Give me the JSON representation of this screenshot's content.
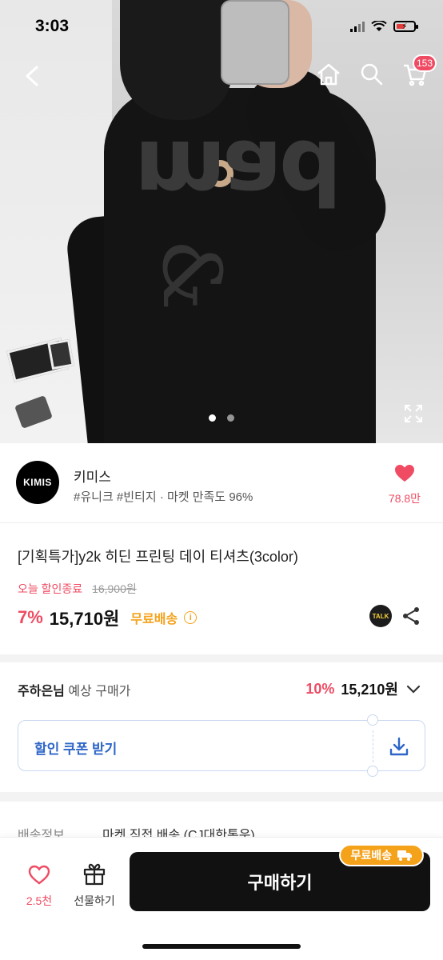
{
  "status_bar": {
    "time": "3:03"
  },
  "nav": {
    "cart_count": "153"
  },
  "gallery": {
    "image_count": 2,
    "active_index": 0,
    "print_text": "mad",
    "print_amp": "&"
  },
  "shop": {
    "logo_text": "KIMIS",
    "name": "키미스",
    "tags": "#유니크 #빈티지 · 마켓 만족도 96%",
    "like_count": "78.8만"
  },
  "product": {
    "title": "[기획특가]y2k 히딘 프린팅 데이 티셔츠(3color)",
    "sale_label": "오늘 할인종료",
    "original_price": "16,900원",
    "discount": "7%",
    "price": "15,710원",
    "free_shipping": "무료배송",
    "talk_label": "TALK"
  },
  "expected_price": {
    "user_name": "주하은님",
    "label": " 예상 구매가",
    "discount": "10%",
    "price": "15,210원"
  },
  "coupon": {
    "label": "할인 쿠폰 받기"
  },
  "shipping": {
    "label": "배송정보",
    "value": "마켓 직접 배송 (CJ대한통운)"
  },
  "bottom_bar": {
    "wish_count": "2.5천",
    "gift_label": "선물하기",
    "buy_label": "구매하기",
    "free_badge": "무료배송"
  },
  "colors": {
    "accent": "#ef4b63",
    "coupon_blue": "#2e66c8",
    "free_ship": "#f5a21b"
  },
  "icons": [
    "back-icon",
    "home-icon",
    "search-icon",
    "cart-icon",
    "expand-icon",
    "heart-icon",
    "info-icon",
    "talk-icon",
    "share-icon",
    "chevron-down-icon",
    "download-icon",
    "gift-icon",
    "truck-icon"
  ]
}
